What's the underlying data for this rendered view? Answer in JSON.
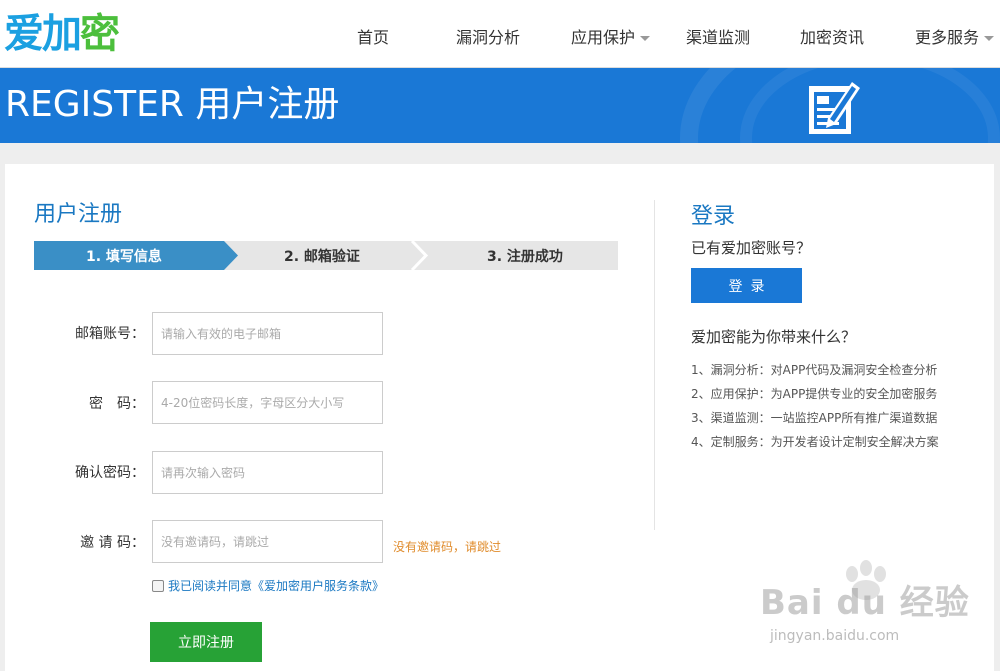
{
  "brand": {
    "logo_text_a": "爱加",
    "logo_text_b": "密"
  },
  "nav": {
    "items": [
      {
        "label": "首页"
      },
      {
        "label": "漏洞分析"
      },
      {
        "label": "应用保护"
      },
      {
        "label": "渠道监测"
      },
      {
        "label": "加密资讯"
      },
      {
        "label": "更多服务"
      }
    ]
  },
  "banner": {
    "title": "REGISTER 用户注册"
  },
  "form": {
    "title": "用户注册",
    "steps": [
      {
        "label": "1. 填写信息",
        "active": true
      },
      {
        "label": "2. 邮箱验证",
        "active": false
      },
      {
        "label": "3. 注册成功",
        "active": false
      }
    ],
    "fields": [
      {
        "label": "邮箱账号：",
        "placeholder": "请输入有效的电子邮箱"
      },
      {
        "label": "密　码：",
        "placeholder": "4-20位密码长度，字母区分大小写"
      },
      {
        "label": "确认密码：",
        "placeholder": "请再次输入密码"
      },
      {
        "label": "邀 请 码：",
        "placeholder": "没有邀请码，请跳过"
      }
    ],
    "invite_hint": "没有邀请码，请跳过",
    "agree_text": "我已阅读并同意《爱加密用户服务条款》",
    "submit_label": "立即注册"
  },
  "side": {
    "title": "登录",
    "subtitle": "已有爱加密账号？",
    "login_label": "登录",
    "question": "爱加密能为你带来什么？",
    "benefits": [
      "1、漏洞分析：对APP代码及漏洞安全检查分析",
      "2、应用保护：为APP提供专业的安全加密服务",
      "3、渠道监测：一站监控APP所有推广渠道数据",
      "4、定制服务：为开发者设计定制安全解决方案"
    ]
  },
  "watermark": {
    "brand": "Bai du 经验",
    "url": "jingyan.baidu.com"
  },
  "colors": {
    "primary": "#1a78d6",
    "green": "#27a236",
    "logo_blue": "#1ba0e1",
    "logo_green": "#4cbf3c",
    "hint": "#e08c2c"
  }
}
